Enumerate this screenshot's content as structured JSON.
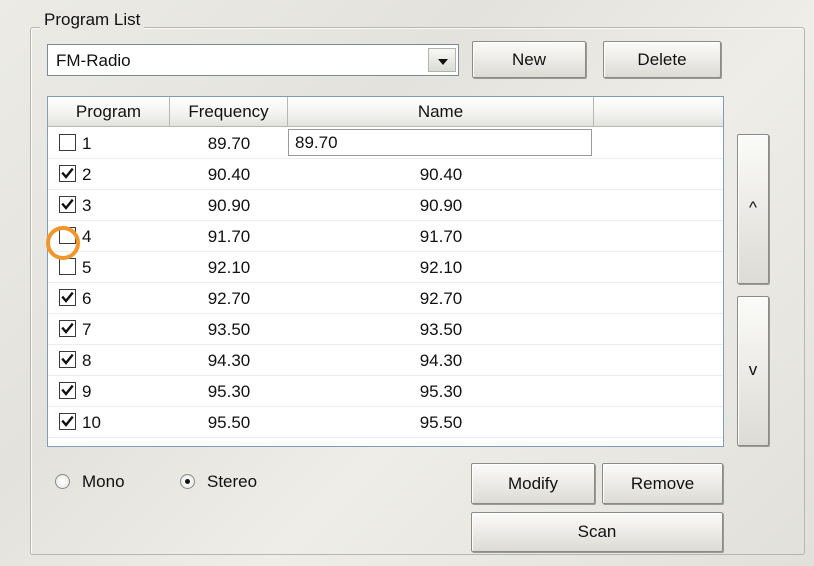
{
  "group": {
    "title": "Program List"
  },
  "combo": {
    "value": "FM-Radio"
  },
  "buttons": {
    "new": "New",
    "delete": "Delete",
    "up": "^",
    "down": "v",
    "modify": "Modify",
    "remove": "Remove",
    "scan": "Scan"
  },
  "table": {
    "headers": [
      "Program",
      "Frequency",
      "Name",
      ""
    ],
    "edit_value": "89.70",
    "rows": [
      {
        "program": "1",
        "frequency": "89.70",
        "name": "89.70",
        "checked": false
      },
      {
        "program": "2",
        "frequency": "90.40",
        "name": "90.40",
        "checked": true
      },
      {
        "program": "3",
        "frequency": "90.90",
        "name": "90.90",
        "checked": true
      },
      {
        "program": "4",
        "frequency": "91.70",
        "name": "91.70",
        "checked": false
      },
      {
        "program": "5",
        "frequency": "92.10",
        "name": "92.10",
        "checked": false
      },
      {
        "program": "6",
        "frequency": "92.70",
        "name": "92.70",
        "checked": true
      },
      {
        "program": "7",
        "frequency": "93.50",
        "name": "93.50",
        "checked": true
      },
      {
        "program": "8",
        "frequency": "94.30",
        "name": "94.30",
        "checked": true
      },
      {
        "program": "9",
        "frequency": "95.30",
        "name": "95.30",
        "checked": true
      },
      {
        "program": "10",
        "frequency": "95.50",
        "name": "95.50",
        "checked": true
      }
    ]
  },
  "audio": {
    "options": [
      {
        "label": "Mono",
        "selected": false
      },
      {
        "label": "Stereo",
        "selected": true
      }
    ]
  },
  "colors": {
    "focus_ring": "#f0962a",
    "list_border": "#7f9db9"
  }
}
